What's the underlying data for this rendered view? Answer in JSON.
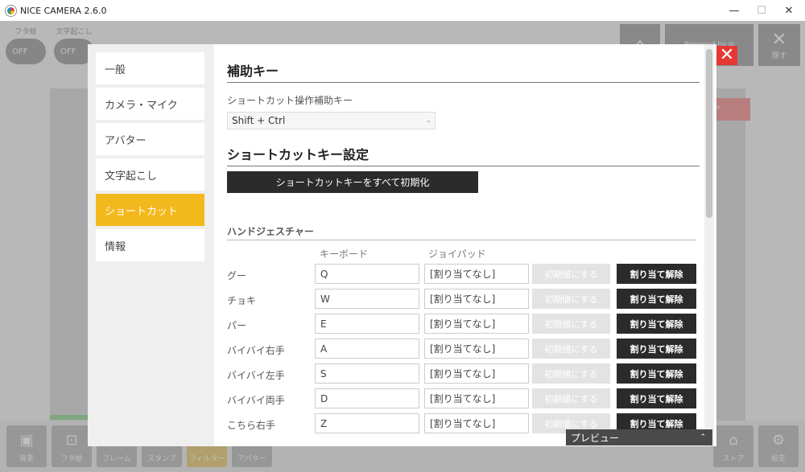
{
  "window": {
    "title": "NICE CAMERA 2.6.0",
    "minimize_icon": "minimize-icon",
    "maximize_icon": "maximize-icon",
    "close_icon": "close-icon"
  },
  "background": {
    "toggles": [
      {
        "label": "フタ絵",
        "value": "OFF"
      },
      {
        "label": "文字起こし",
        "value": "OFF"
      }
    ],
    "top_right": {
      "powered_by": "Powered by ⧉",
      "hide_label": "隠す"
    },
    "bottom_tools": [
      "背景",
      "フタ絵",
      "フレーム",
      "スタンプ",
      "フィルター",
      "アバター"
    ],
    "bottom_right_tools": [
      "ストア",
      "設定"
    ]
  },
  "dialog": {
    "sidebar": [
      "一般",
      "カメラ・マイク",
      "アバター",
      "文字起こし",
      "ショートカット",
      "情報"
    ],
    "active_index": 4,
    "modifier": {
      "heading": "補助キー",
      "label": "ショートカット操作補助キー",
      "value": "Shift + Ctrl"
    },
    "shortcut": {
      "heading": "ショートカットキー設定",
      "reset_all_label": "ショートカットキーをすべて初期化"
    },
    "gestures": {
      "heading": "ハンドジェスチャー",
      "col_keyboard": "キーボード",
      "col_joypad": "ジョイパッド",
      "default_label": "初期値にする",
      "clear_label": "割り当て解除",
      "rows": [
        {
          "name": "グー",
          "keyboard": "Q",
          "joypad": "[割り当てなし]"
        },
        {
          "name": "チョキ",
          "keyboard": "W",
          "joypad": "[割り当てなし]"
        },
        {
          "name": "パー",
          "keyboard": "E",
          "joypad": "[割り当てなし]"
        },
        {
          "name": "バイバイ右手",
          "keyboard": "A",
          "joypad": "[割り当てなし]"
        },
        {
          "name": "バイバイ左手",
          "keyboard": "S",
          "joypad": "[割り当てなし]"
        },
        {
          "name": "バイバイ両手",
          "keyboard": "D",
          "joypad": "[割り当てなし]"
        },
        {
          "name": "こちら右手",
          "keyboard": "Z",
          "joypad": "[割り当てなし]"
        }
      ]
    }
  },
  "preview": {
    "label": "プレビュー"
  }
}
